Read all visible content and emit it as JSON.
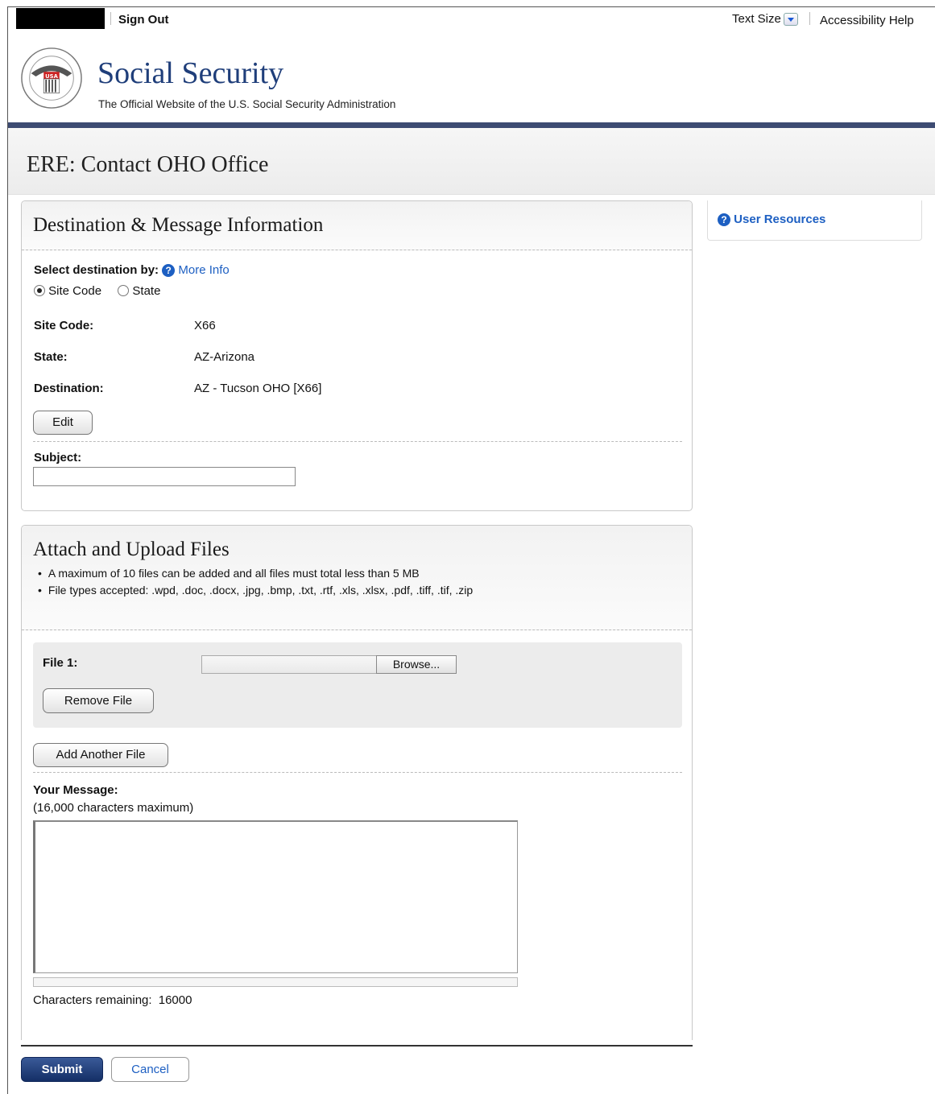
{
  "topbar": {
    "sign_out": "Sign Out",
    "text_size": "Text Size",
    "accessibility_help": "Accessibility Help"
  },
  "header": {
    "title": "Social Security",
    "subtitle": "The Official Website of the U.S. Social Security Administration",
    "logo_text": "SOCIAL SECURITY ADMINISTRATION USA"
  },
  "page": {
    "title": "ERE: Contact OHO Office"
  },
  "destination": {
    "section_title": "Destination & Message Information",
    "select_label": "Select destination by:",
    "more_info": "More Info",
    "radio_site_code": "Site Code",
    "radio_state": "State",
    "selected": "site_code",
    "site_code_label": "Site Code:",
    "site_code_value": "X66",
    "state_label": "State:",
    "state_value": "AZ-Arizona",
    "destination_label": "Destination:",
    "destination_value": "AZ - Tucson OHO [X66]",
    "edit_button": "Edit",
    "subject_label": "Subject:",
    "subject_value": ""
  },
  "attach": {
    "section_title": "Attach and Upload Files",
    "bullets": [
      "A maximum of 10 files can be added and all files must total less than 5 MB",
      "File types accepted: .wpd, .doc, .docx, .jpg, .bmp, .txt, .rtf, .xls, .xlsx, .pdf, .tiff, .tif, .zip"
    ],
    "file_label": "File 1:",
    "browse_button": "Browse...",
    "remove_button": "Remove File",
    "add_button": "Add Another File",
    "message_label": "Your Message:",
    "message_hint": "(16,000 characters maximum)",
    "message_value": "",
    "chars_remaining_label": "Characters remaining:",
    "chars_remaining_value": "16000"
  },
  "sidebar": {
    "user_resources": "User Resources"
  },
  "actions": {
    "submit": "Submit",
    "cancel": "Cancel"
  },
  "colors": {
    "brand_blue": "#1f3e7a",
    "header_bar": "#3d4b72",
    "link_blue": "#1d5fc2",
    "submit_bg": "#142f66"
  }
}
